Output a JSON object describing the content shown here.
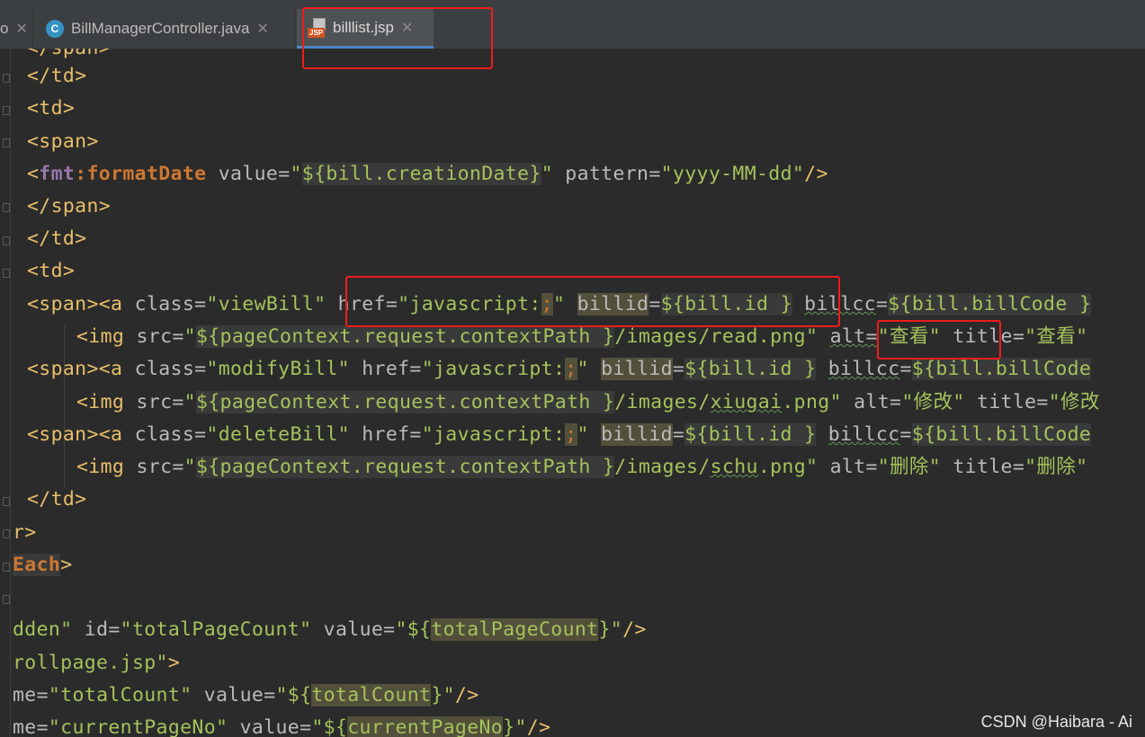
{
  "tabs": [
    {
      "label": "o",
      "close": "✕"
    },
    {
      "label": "BillManagerController.java",
      "icon": "C",
      "close": "✕"
    },
    {
      "label": "billlist.jsp",
      "icon": "JSP",
      "close": "✕",
      "active": true
    }
  ],
  "code": {
    "l0": "</span>",
    "l1": "</td>",
    "l2": "<td>",
    "l3": "<span>",
    "l4": {
      "open": "<",
      "ns": "fmt",
      "colon": ":",
      "tag": "formatDate",
      "attr1": " value=",
      "q1": "\"",
      "el": "${bill.creationDate}",
      "q2": "\"",
      "attr2": " pattern=",
      "val2": "\"yyyy-MM-dd\"",
      "close": "/>"
    },
    "l5": "</span>",
    "l6": "</td>",
    "l7": "<td>",
    "l8": {
      "tag": "<span><a",
      "class_attr": " class=",
      "class_val": "\"viewBill\"",
      "href_attr": " href=",
      "href_val1": "\"javascript:",
      "semi": ";",
      "href_val2": "\"",
      "billid": "billid",
      "eq": "=",
      "el": "${bill.id }",
      "billcc": "billcc",
      "eq2": "=",
      "el2": "${bill.billCode }"
    },
    "l9": {
      "tag": "<img",
      "src_attr": " src=",
      "q": "\"",
      "el": "${pageContext.request.contextPath }",
      "path": "/images/read.png\"",
      "alt_attr": "alt=",
      "alt_val": "\"查看\"",
      "title_attr": "title=",
      "title_val": "\"查看\""
    },
    "l10": {
      "tag": "<span><a",
      "class_attr": " class=",
      "class_val": "\"modifyBill\"",
      "href_attr": " href=",
      "href_val1": "\"javascript:",
      "semi": ";",
      "href_val2": "\"",
      "billid": "billid",
      "eq": "=",
      "el": "${bill.id }",
      "billcc": "billcc",
      "eq2": "=",
      "el2": "${bill.billCode"
    },
    "l11": {
      "tag": "<img",
      "src_attr": " src=",
      "q": "\"",
      "el": "${pageContext.request.contextPath }",
      "path1": "/images/",
      "path_sq": "xiugai",
      "path2": ".png\"",
      "alt_attr": "alt=",
      "alt_val": "\"修改\"",
      "title_attr": "title=",
      "title_val": "\"修改"
    },
    "l12": {
      "tag": "<span><a",
      "class_attr": " class=",
      "class_val": "\"deleteBill\"",
      "href_attr": " href=",
      "href_val1": "\"javascript:",
      "semi": ";",
      "href_val2": "\"",
      "billid": "billid",
      "eq": "=",
      "el": "${bill.id }",
      "billcc": "billcc",
      "eq2": "=",
      "el2": "${bill.billCode"
    },
    "l13": {
      "tag": "<img",
      "src_attr": " src=",
      "q": "\"",
      "el": "${pageContext.request.contextPath }",
      "path1": "/images/",
      "path_sq": "schu",
      "path2": ".png\"",
      "alt_attr": "alt=",
      "alt_val": "\"删除\"",
      "title_attr": "title=",
      "title_val": "\"删除\""
    },
    "l14": "</td>",
    "l15": "r>",
    "l16": {
      "word": "Each",
      "close": ">"
    },
    "l18": {
      "a": "dden\"",
      "b": " id=",
      "c": "\"totalPageCount\"",
      "d": " value=",
      "e": "\"${",
      "f": "totalPageCount",
      "g": "}\"",
      "h": "/>"
    },
    "l19": {
      "a": "rollpage.jsp\"",
      "b": ">"
    },
    "l20": {
      "a": "me=",
      "b": "\"totalCount\"",
      "c": " value=",
      "d": "\"${",
      "e": "totalCount",
      "f": "}\"",
      "g": "/>"
    },
    "l21": {
      "a": "me=",
      "b": "\"currentPageNo\"",
      "c": " value=",
      "d": "\"${",
      "e": "currentPageNo",
      "f": "}\"",
      "g": "/>"
    }
  },
  "watermark": "CSDN @Haibara - Ai"
}
